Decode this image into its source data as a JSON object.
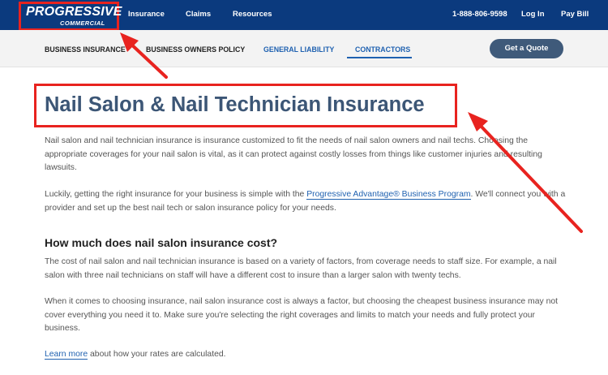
{
  "header": {
    "logo": {
      "main": "PROGRESSIVE",
      "sub": "COMMERCIAL"
    },
    "nav": [
      "Insurance",
      "Claims",
      "Resources"
    ],
    "phone": "1-888-806-9598",
    "login": "Log In",
    "pay_bill": "Pay Bill"
  },
  "subnav": {
    "items": [
      "BUSINESS INSURANCE",
      "BUSINESS OWNERS POLICY",
      "GENERAL LIABILITY",
      "CONTRACTORS"
    ],
    "cta": "Get a Quote"
  },
  "main": {
    "title": "Nail Salon & Nail Technician Insurance",
    "p1": "Nail salon and nail technician insurance is insurance customized to fit the needs of nail salon owners and nail techs. Choosing the appropriate coverages for your nail salon is vital, as it can protect against costly losses from things like customer injuries and resulting lawsuits.",
    "p2_before": "Luckily, getting the right insurance for your business is simple with the ",
    "p2_link": "Progressive Advantage® Business Program",
    "p2_after": ". We'll connect you with a provider and set up the best nail tech or salon insurance policy for your needs.",
    "h2": "How much does nail salon insurance cost?",
    "p3": "The cost of nail salon and nail technician insurance is based on a variety of factors, from coverage needs to staff size. For example, a nail salon with three nail technicians on staff will have a different cost to insure than a larger salon with twenty techs.",
    "p4": "When it comes to choosing insurance, nail salon insurance cost is always a factor, but choosing the cheapest business insurance may not cover everything you need it to. Make sure you're selecting the right coverages and limits to match your needs and fully protect your business.",
    "p5_link": "Learn more",
    "p5_after": " about how your rates are calculated."
  },
  "annotation_color": "#e8231f"
}
